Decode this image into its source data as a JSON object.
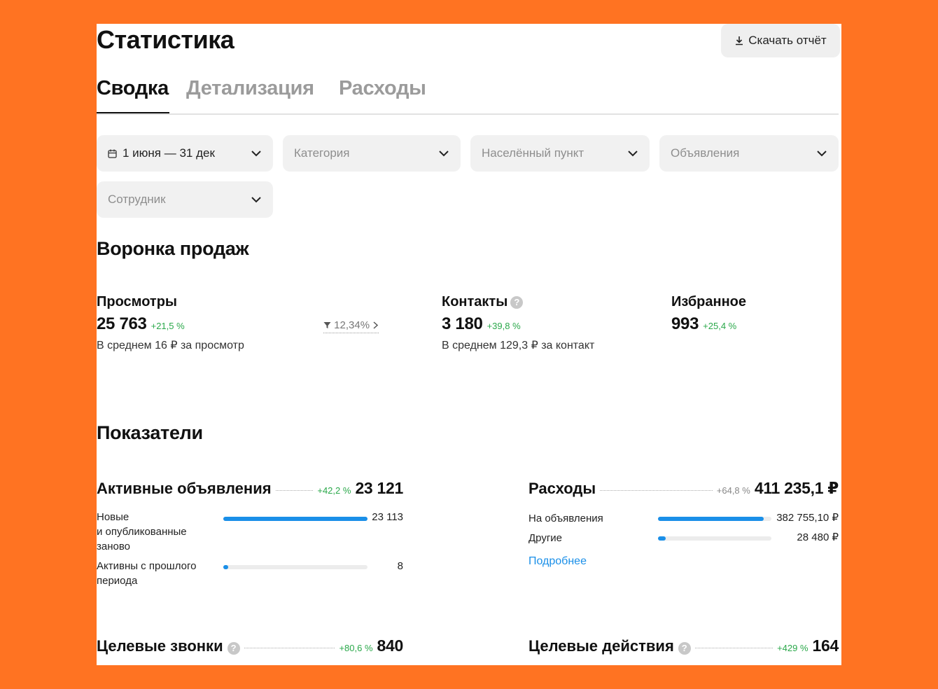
{
  "header": {
    "title": "Статистика",
    "download_label": "Скачать отчёт"
  },
  "tabs": [
    {
      "label": "Сводка",
      "active": true
    },
    {
      "label": "Детализация",
      "active": false
    },
    {
      "label": "Расходы",
      "active": false
    }
  ],
  "filters": {
    "period": "1 июня — 31 дек",
    "category": "Категория",
    "locality": "Населённый пункт",
    "listings": "Объявления",
    "employee": "Сотрудник"
  },
  "funnel": {
    "title": "Воронка продаж",
    "views": {
      "label": "Просмотры",
      "value": "25 763",
      "delta": "+21,5 %",
      "note": "В среднем 16 ₽ за просмотр",
      "conversion": "12,34%"
    },
    "contacts": {
      "label": "Контакты",
      "value": "3 180",
      "delta": "+39,8 %",
      "note": "В среднем 129,3 ₽ за контакт"
    },
    "favorites": {
      "label": "Избранное",
      "value": "993",
      "delta": "+25,4 %"
    }
  },
  "indicators": {
    "title": "Показатели",
    "active_listings": {
      "name": "Активные объявления",
      "delta": "+42,2 %",
      "value": "23 121",
      "items": [
        {
          "label_lines": [
            "Новые",
            "и опубликованные",
            "заново"
          ],
          "value": "23 113",
          "fraction": 0.999
        },
        {
          "label_lines": [
            "Активны с прошлого",
            "периода"
          ],
          "value": "8",
          "fraction": 0.02
        }
      ]
    },
    "expenses": {
      "name": "Расходы",
      "delta": "+64,8 %",
      "value": "411 235,1 ₽",
      "items": [
        {
          "label": "На объявления",
          "value": "382 755,10 ₽",
          "fraction": 0.93
        },
        {
          "label": "Другие",
          "value": "28 480 ₽",
          "fraction": 0.07
        }
      ],
      "more_link": "Подробнее"
    },
    "target_calls": {
      "name": "Целевые звонки",
      "delta": "+80,6 %",
      "value": "840"
    },
    "target_actions": {
      "name": "Целевые действия",
      "delta": "+429 %",
      "value": "164"
    }
  },
  "colors": {
    "accent": "#1a8fe8",
    "positive": "#2aa84a",
    "page_bg": "#FF7322"
  },
  "icons": [
    "download-icon",
    "calendar-icon",
    "chevron-down-icon",
    "help-icon",
    "funnel-icon",
    "chevron-right-icon"
  ]
}
